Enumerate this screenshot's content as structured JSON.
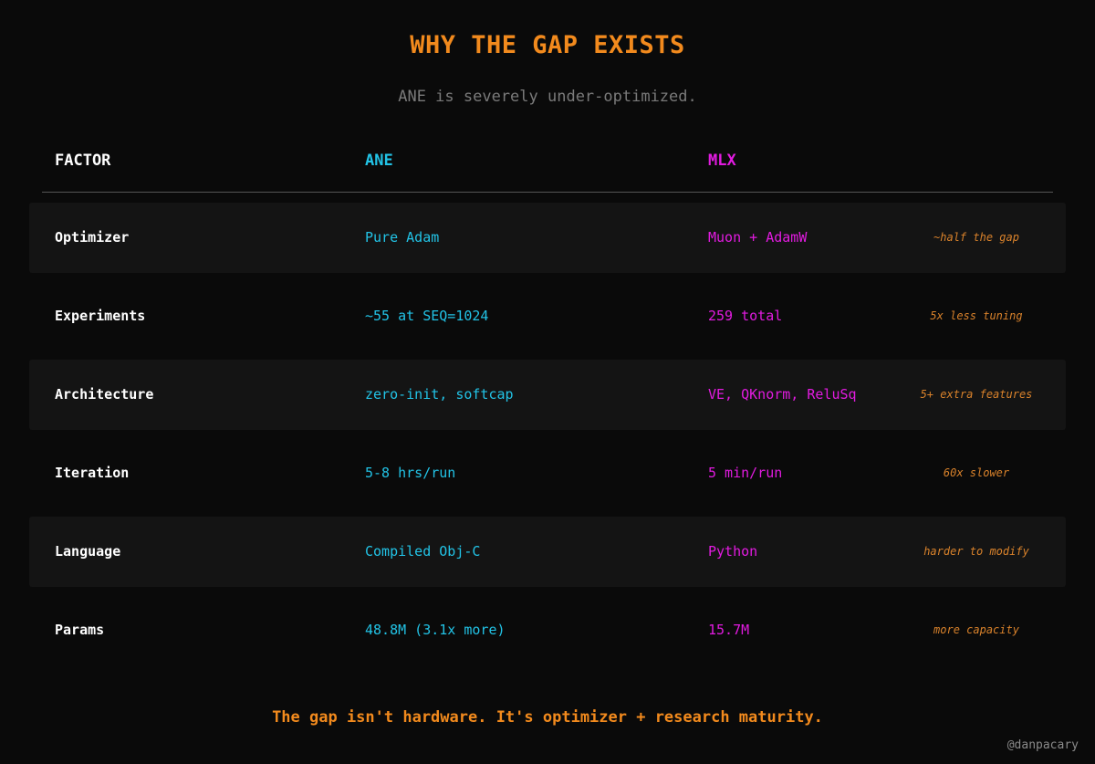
{
  "title": "WHY THE GAP EXISTS",
  "subtitle": "ANE is severely under-optimized.",
  "table": {
    "headers": {
      "factor": "FACTOR",
      "ane": "ANE",
      "mlx": "MLX"
    },
    "rows": [
      {
        "factor": "Optimizer",
        "ane": "Pure Adam",
        "mlx": "Muon + AdamW",
        "note": "~half the gap"
      },
      {
        "factor": "Experiments",
        "ane": "~55 at SEQ=1024",
        "mlx": "259 total",
        "note": "5x less tuning"
      },
      {
        "factor": "Architecture",
        "ane": "zero-init, softcap",
        "mlx": "VE, QKnorm, ReluSq",
        "note": "5+ extra features"
      },
      {
        "factor": "Iteration",
        "ane": "5-8 hrs/run",
        "mlx": "5 min/run",
        "note": "60x slower"
      },
      {
        "factor": "Language",
        "ane": "Compiled Obj-C",
        "mlx": "Python",
        "note": "harder to modify"
      },
      {
        "factor": "Params",
        "ane": "48.8M (3.1x more)",
        "mlx": "15.7M",
        "note": "more capacity"
      }
    ]
  },
  "footer": "The gap isn't hardware. It's optimizer + research maturity.",
  "credit": "@danpacary",
  "colors": {
    "background": "#0a0a0a",
    "accent_orange": "#f28a1d",
    "ane_cyan": "#22c3e6",
    "mlx_magenta": "#e21be0",
    "row_band": "#141414"
  }
}
